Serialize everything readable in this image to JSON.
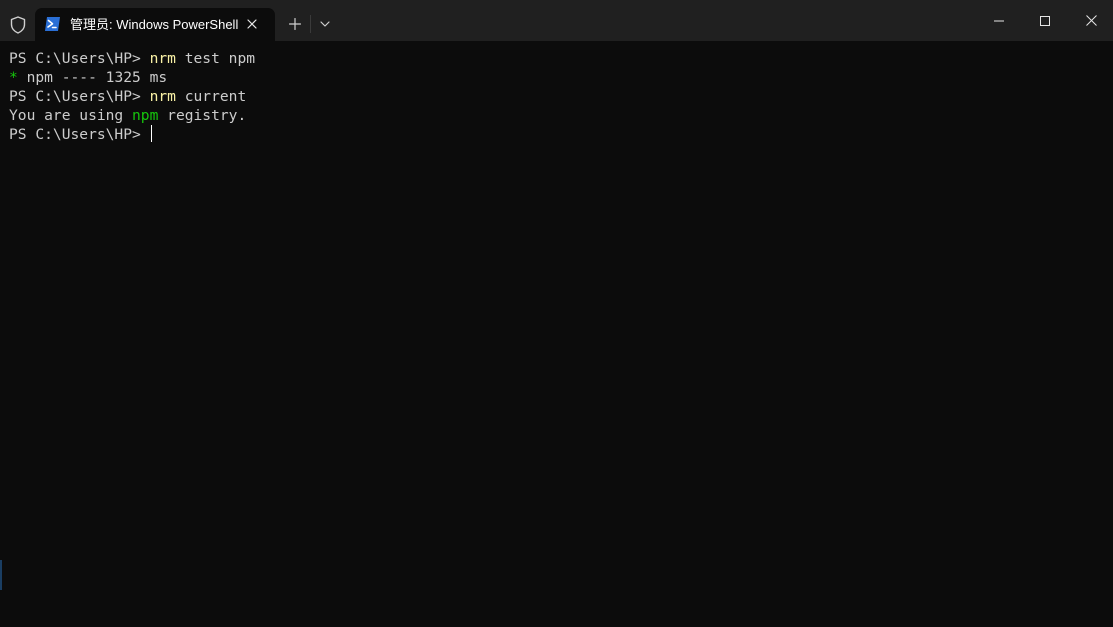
{
  "window": {
    "tab_title": "管理员: Windows PowerShell",
    "icons": {
      "shield": "shield-icon",
      "tab": "powershell-icon",
      "close_tab": "close-icon",
      "new_tab": "plus-icon",
      "dropdown": "chevron-down-icon",
      "minimize": "minimize-icon",
      "maximize": "maximize-icon",
      "close_window": "close-icon"
    }
  },
  "colors": {
    "background": "#0c0c0c",
    "titlebar": "#202020",
    "text": "#cccccc",
    "command": "#f9f1a5",
    "success": "#16c60c",
    "accent": "#2a6fd6"
  },
  "terminal": {
    "line1": {
      "prompt": "PS C:\\Users\\HP> ",
      "cmd": "nrm",
      "args": " test npm"
    },
    "line2": {
      "star": "*",
      "text": " npm ---- 1325 ms"
    },
    "line3": {
      "prompt": "PS C:\\Users\\HP> ",
      "cmd": "nrm",
      "args": " current"
    },
    "line4": {
      "before": "You are using ",
      "highlight": "npm",
      "after": " registry."
    },
    "line5": {
      "prompt": "PS C:\\Users\\HP> "
    }
  }
}
